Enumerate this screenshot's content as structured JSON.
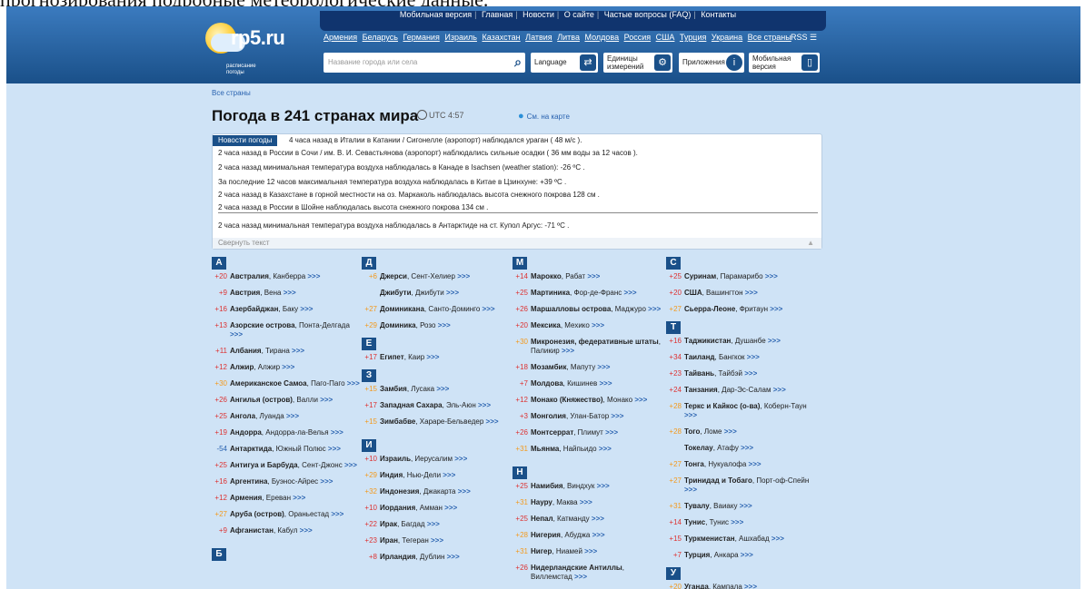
{
  "partial_top_text": "прогнозирования подробные метеорологические данные.",
  "top_menu": [
    "Мобильная версия",
    "Главная",
    "Новости",
    "О сайте",
    "Частые вопросы (FAQ)",
    "Контакты"
  ],
  "country_links": [
    "Армения",
    "Беларусь",
    "Германия",
    "Израиль",
    "Казахстан",
    "Латвия",
    "Литва",
    "Молдова",
    "Россия",
    "США",
    "Турция",
    "Украина",
    "Все страны"
  ],
  "rss": "RSS",
  "logo": {
    "name": "rp5.ru",
    "subtitle1": "расписание",
    "subtitle2": "погоды"
  },
  "search": {
    "placeholder": "Название города или села"
  },
  "buttons": {
    "language": "Language",
    "units1": "Единицы",
    "units2": "измерений",
    "apps": "Приложения",
    "mobile1": "Мобильная",
    "mobile2": "версия"
  },
  "breadcrumb": "Все страны",
  "page_title": "Погода в 241 странах мира",
  "utc": "UTC 4:57",
  "map_link": "См. на карте",
  "news": {
    "tag": "Новости погоды",
    "lines": [
      "4 часа назад в Италии в Катании / Сигонелле (аэропорт) наблюдался ураган ( 48 м/с ).",
      "2 часа назад в России в Сочи / им. В. И. Севастьянова (аэропорт) наблюдались сильные осадки ( 36 мм воды за 12 часов ).",
      "2 часа назад минимальная температура воздуха наблюдалась в Канаде в Isachsen (weather station): -26 ºC .",
      "За последние 12 часов максимальная температура воздуха наблюдалась в Китае в Цзинхуне: +39 ºC .",
      "2 часа назад в Казахстане в горной местности на оз. Маркаколь наблюдалась высота снежного покрова 128 см .",
      "2 часа назад в России в Шойне наблюдалась высота снежного покрова 134 см .",
      "2 часа назад минимальная температура воздуха наблюдалась в Антарктиде на ст. Купол Аргус: -71 ºC ."
    ],
    "collapse": "Свернуть текст"
  },
  "columns": [
    [
      {
        "letter": "А"
      },
      {
        "t": "+20",
        "c": "red",
        "country": "Австралия",
        "city": ", Канберра"
      },
      {
        "t": "+9",
        "c": "red",
        "country": "Австрия",
        "city": ", Вена"
      },
      {
        "t": "+16",
        "c": "red",
        "country": "Азербайджан",
        "city": ", Баку"
      },
      {
        "t": "+13",
        "c": "red",
        "country": "Азорские острова",
        "city": ", Понта-Делгада"
      },
      {
        "t": "+11",
        "c": "red",
        "country": "Албания",
        "city": ", Тирана"
      },
      {
        "t": "+12",
        "c": "red",
        "country": "Алжир",
        "city": ", Алжир"
      },
      {
        "t": "+30",
        "c": "ora",
        "country": "Американское Самоа",
        "city": ", Паго-Паго"
      },
      {
        "t": "+26",
        "c": "red",
        "country": "Ангилья (остров)",
        "city": ", Валли"
      },
      {
        "t": "+25",
        "c": "red",
        "country": "Ангола",
        "city": ", Луанда"
      },
      {
        "t": "+19",
        "c": "red",
        "country": "Андорра",
        "city": ", Андорра-ла-Велья"
      },
      {
        "t": "-54",
        "c": "blu",
        "country": "Антарктида",
        "city": ", Южный Полюс"
      },
      {
        "t": "+25",
        "c": "red",
        "country": "Антигуа и Барбуда",
        "city": ", Сент-Джонс"
      },
      {
        "t": "+16",
        "c": "red",
        "country": "Аргентина",
        "city": ", Буэнос-Айрес"
      },
      {
        "t": "+12",
        "c": "red",
        "country": "Армения",
        "city": ", Ереван"
      },
      {
        "t": "+27",
        "c": "ora",
        "country": "Аруба (остров)",
        "city": ", Ораньестад"
      },
      {
        "t": "+9",
        "c": "red",
        "country": "Афганистан",
        "city": ", Кабул"
      },
      {
        "gap": true
      },
      {
        "letter": "Б"
      }
    ],
    [
      {
        "letter": "Д"
      },
      {
        "t": "+6",
        "c": "ora",
        "country": "Джерси",
        "city": ", Сент-Хелиер"
      },
      {
        "t": "",
        "c": "red",
        "country": "Джибути",
        "city": ", Джибути"
      },
      {
        "t": "+27",
        "c": "ora",
        "country": "Доминикана",
        "city": ", Санто-Доминго"
      },
      {
        "t": "+29",
        "c": "ora",
        "country": "Доминика",
        "city": ", Розо"
      },
      {
        "letter": "Е"
      },
      {
        "t": "+17",
        "c": "red",
        "country": "Египет",
        "city": ", Каир"
      },
      {
        "letter": "З"
      },
      {
        "t": "+15",
        "c": "ora",
        "country": "Замбия",
        "city": ", Лусака"
      },
      {
        "t": "+17",
        "c": "red",
        "country": "Западная Сахара",
        "city": ", Эль-Аюн"
      },
      {
        "t": "+15",
        "c": "ora",
        "country": "Зимбабве",
        "city": ", Хараре-Бельведер"
      },
      {
        "gap": true
      },
      {
        "letter": "И"
      },
      {
        "t": "+10",
        "c": "red",
        "country": "Израиль",
        "city": ", Иерусалим"
      },
      {
        "t": "+29",
        "c": "ora",
        "country": "Индия",
        "city": ", Нью-Дели"
      },
      {
        "t": "+32",
        "c": "ora",
        "country": "Индонезия",
        "city": ", Джакарта"
      },
      {
        "t": "+10",
        "c": "red",
        "country": "Иордания",
        "city": ", Амман"
      },
      {
        "t": "+22",
        "c": "red",
        "country": "Ирак",
        "city": ", Багдад"
      },
      {
        "t": "+23",
        "c": "red",
        "country": "Иран",
        "city": ", Тегеран"
      },
      {
        "t": "+8",
        "c": "red",
        "country": "Ирландия",
        "city": ", Дублин"
      }
    ],
    [
      {
        "letter": "М"
      },
      {
        "t": "+14",
        "c": "red",
        "country": "Марокко",
        "city": ", Рабат"
      },
      {
        "t": "+25",
        "c": "red",
        "country": "Мартиника",
        "city": ", Фор-де-Франс"
      },
      {
        "t": "+26",
        "c": "red",
        "country": "Маршалловы острова",
        "city": ", Маджуро"
      },
      {
        "t": "+20",
        "c": "red",
        "country": "Мексика",
        "city": ", Мехико"
      },
      {
        "t": "+30",
        "c": "ora",
        "country": "Микронезия, федеративные штаты",
        "city": ", Паликир"
      },
      {
        "t": "+18",
        "c": "red",
        "country": "Мозамбик",
        "city": ", Мапуту"
      },
      {
        "t": "+7",
        "c": "red",
        "country": "Молдова",
        "city": ", Кишинев"
      },
      {
        "t": "+12",
        "c": "red",
        "country": "Монако (Княжество)",
        "city": ", Монако"
      },
      {
        "t": "+3",
        "c": "red",
        "country": "Монголия",
        "city": ", Улан-Батор"
      },
      {
        "t": "+26",
        "c": "red",
        "country": "Монтсеррат",
        "city": ", Плимут"
      },
      {
        "t": "+31",
        "c": "ora",
        "country": "Мьянма",
        "city": ", Найпьидо"
      },
      {
        "gap": true
      },
      {
        "letter": "Н"
      },
      {
        "t": "+25",
        "c": "red",
        "country": "Намибия",
        "city": ", Виндхук"
      },
      {
        "t": "+31",
        "c": "ora",
        "country": "Науру",
        "city": ", Маква"
      },
      {
        "t": "+25",
        "c": "red",
        "country": "Непал",
        "city": ", Катманду"
      },
      {
        "t": "+28",
        "c": "ora",
        "country": "Нигерия",
        "city": ", Абуджа"
      },
      {
        "t": "+31",
        "c": "ora",
        "country": "Нигер",
        "city": ", Ниамей"
      },
      {
        "t": "+26",
        "c": "red",
        "country": "Нидерландские Антиллы",
        "city": ", Виллемстад"
      }
    ],
    [
      {
        "letter": "С"
      },
      {
        "t": "+25",
        "c": "red",
        "country": "Суринам",
        "city": ", Парамарибо"
      },
      {
        "t": "+20",
        "c": "red",
        "country": "США",
        "city": ", Вашингтон"
      },
      {
        "t": "+27",
        "c": "ora",
        "country": "Сьерра-Леоне",
        "city": ", Фритаун"
      },
      {
        "letter": "Т"
      },
      {
        "t": "+16",
        "c": "red",
        "country": "Таджикистан",
        "city": ", Душанбе"
      },
      {
        "t": "+34",
        "c": "red",
        "country": "Таиланд",
        "city": ", Бангкок"
      },
      {
        "t": "+23",
        "c": "red",
        "country": "Тайвань",
        "city": ", Тайбэй"
      },
      {
        "t": "+24",
        "c": "red",
        "country": "Танзания",
        "city": ", Дар-Эс-Салам"
      },
      {
        "t": "+28",
        "c": "ora",
        "country": "Теркс и Кайкос (о-ва)",
        "city": ", Коберн-Таун"
      },
      {
        "t": "+28",
        "c": "ora",
        "country": "Того",
        "city": ", Ломе"
      },
      {
        "t": "",
        "c": "red",
        "country": "Токелау",
        "city": ", Атафу"
      },
      {
        "t": "+27",
        "c": "ora",
        "country": "Тонга",
        "city": ", Нукуалофа"
      },
      {
        "t": "+27",
        "c": "ora",
        "country": "Тринидад и Тобаго",
        "city": ", Порт-оф-Спейн"
      },
      {
        "t": "+31",
        "c": "ora",
        "country": "Тувалу",
        "city": ", Ваиаку"
      },
      {
        "t": "+14",
        "c": "red",
        "country": "Тунис",
        "city": ", Тунис"
      },
      {
        "t": "+15",
        "c": "red",
        "country": "Туркменистан",
        "city": ", Ашхабад"
      },
      {
        "t": "+7",
        "c": "red",
        "country": "Турция",
        "city": ", Анкара"
      },
      {
        "letter": "У"
      },
      {
        "t": "+20",
        "c": "ora",
        "country": "Уганда",
        "city": ", Кампала"
      }
    ]
  ],
  "more_arrow": ">>>"
}
